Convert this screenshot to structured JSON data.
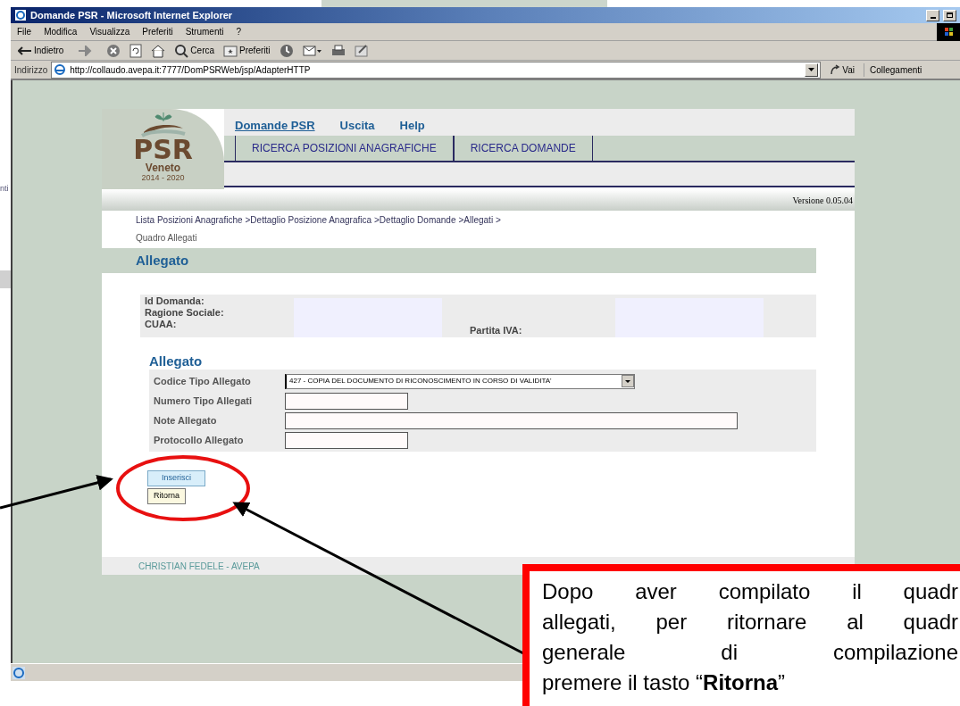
{
  "background_fragment": "nti",
  "window": {
    "title": "Domande PSR - Microsoft Internet Explorer"
  },
  "menu_bar": [
    "File",
    "Modifica",
    "Visualizza",
    "Preferiti",
    "Strumenti",
    "?"
  ],
  "toolbar": [
    {
      "kind": "back",
      "label": "Indietro"
    },
    {
      "kind": "forward"
    },
    {
      "kind": "stop"
    },
    {
      "kind": "refresh"
    },
    {
      "kind": "home"
    },
    {
      "kind": "search",
      "label": "Cerca"
    },
    {
      "kind": "favorites",
      "label": "Preferiti"
    },
    {
      "kind": "history"
    },
    {
      "kind": "mail"
    },
    {
      "kind": "print"
    },
    {
      "kind": "edit"
    }
  ],
  "address_bar": {
    "label": "Indirizzo",
    "url": "http://collaudo.avepa.it:7777/DomPSRWeb/jsp/AdapterHTTP",
    "go": "Vai",
    "links": "Collegamenti"
  },
  "page": {
    "logo": {
      "name": "PSR",
      "region": "Veneto",
      "years": "2014 - 2020"
    },
    "nav_links": [
      {
        "label": "Domande PSR",
        "selected": true
      },
      {
        "label": "Uscita",
        "selected": false
      },
      {
        "label": "Help",
        "selected": false
      }
    ],
    "tabs": [
      "RICERCA POSIZIONI ANAGRAFICHE",
      "RICERCA DOMANDE"
    ],
    "version": "Versione 0.05.04",
    "breadcrumb": [
      "Lista Posizioni Anagrafiche",
      ">Dettaglio Posizione Anagrafica",
      ">Dettaglio Domande",
      ">Allegati",
      ">"
    ],
    "breadcrumb_current": "Quadro Allegati",
    "title": "Allegato",
    "summary": {
      "labels": [
        "Id Domanda:",
        "Ragione Sociale:",
        "CUAA:"
      ],
      "vat_label": "Partita IVA:"
    },
    "form": {
      "title": "Allegato",
      "rows": [
        {
          "label": "Codice Tipo Allegato",
          "kind": "select",
          "value": "427 - COPIA DEL DOCUMENTO DI RICONOSCIMENTO IN CORSO DI VALIDITA'"
        },
        {
          "label": "Numero Tipo Allegati",
          "kind": "short-input"
        },
        {
          "label": "Note Allegato",
          "kind": "long-input"
        },
        {
          "label": "Protocollo Allegato",
          "kind": "short-input"
        }
      ]
    },
    "buttons": [
      {
        "label": "Inserisci",
        "kind": "primary"
      },
      {
        "label": "Ritorna",
        "kind": "secondary"
      }
    ],
    "footer": "CHRISTIAN FEDELE - AVEPA"
  },
  "callout": {
    "lines": [
      "Dopo aver compilato il quadr",
      "allegati, per ritornare al quadr",
      "generale di compilazione",
      "premere il tasto “**Ritorna**”"
    ]
  }
}
